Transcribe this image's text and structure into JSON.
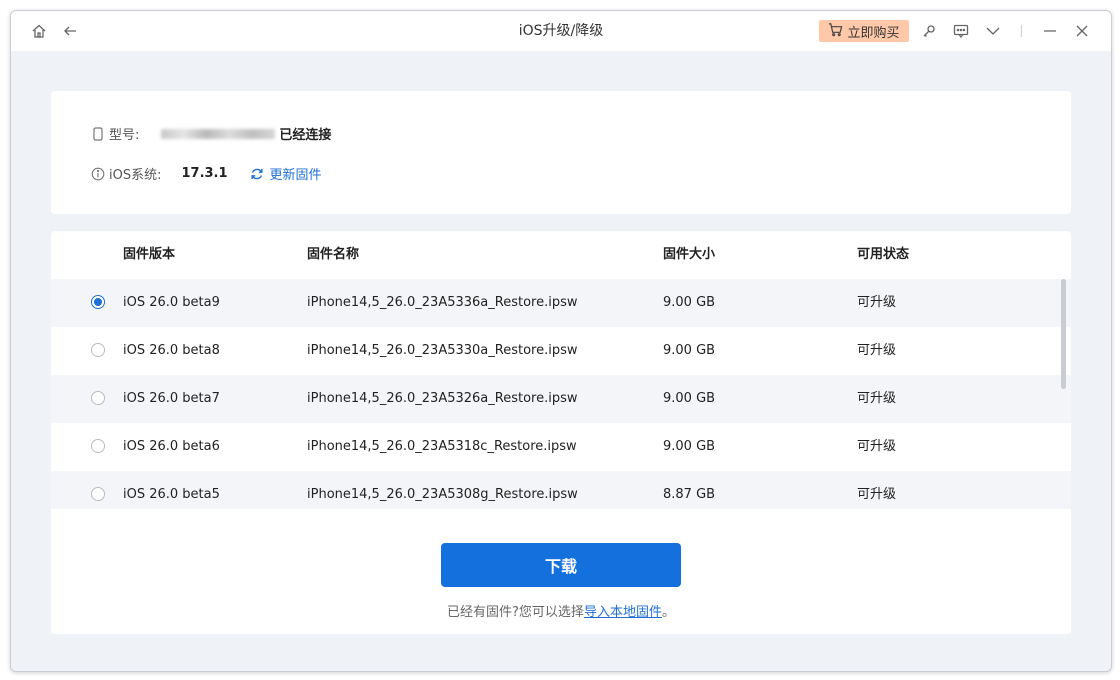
{
  "titlebar": {
    "title": "iOS升级/降级",
    "buy_label": "立即购买",
    "icons": [
      "home-icon",
      "back-icon",
      "cart-icon",
      "key-icon",
      "feedback-icon",
      "chevron-down-icon",
      "minimize-icon",
      "close-icon"
    ]
  },
  "device": {
    "model_label": "型号:",
    "connected_text": "已经连接",
    "ios_label": "iOS系统:",
    "ios_version": "17.3.1",
    "update_label": "更新固件"
  },
  "table": {
    "headers": [
      "固件版本",
      "固件名称",
      "固件大小",
      "可用状态"
    ],
    "rows": [
      {
        "version": "iOS 26.0 beta9",
        "name": "iPhone14,5_26.0_23A5336a_Restore.ipsw",
        "size": "9.00 GB",
        "status": "可升级",
        "selected": true
      },
      {
        "version": "iOS 26.0 beta8",
        "name": "iPhone14,5_26.0_23A5330a_Restore.ipsw",
        "size": "9.00 GB",
        "status": "可升级",
        "selected": false
      },
      {
        "version": "iOS 26.0 beta7",
        "name": "iPhone14,5_26.0_23A5326a_Restore.ipsw",
        "size": "9.00 GB",
        "status": "可升级",
        "selected": false
      },
      {
        "version": "iOS 26.0 beta6",
        "name": "iPhone14,5_26.0_23A5318c_Restore.ipsw",
        "size": "9.00 GB",
        "status": "可升级",
        "selected": false
      },
      {
        "version": "iOS 26.0 beta5",
        "name": "iPhone14,5_26.0_23A5308g_Restore.ipsw",
        "size": "8.87 GB",
        "status": "可升级",
        "selected": false
      }
    ]
  },
  "actions": {
    "download_label": "下载",
    "hint_prefix": "已经有固件?您可以选择",
    "hint_link": "导入本地固件",
    "hint_suffix": "。"
  },
  "colors": {
    "accent": "#1470dc",
    "buy_bg": "#ffc9a9",
    "background": "#eff3f8"
  }
}
